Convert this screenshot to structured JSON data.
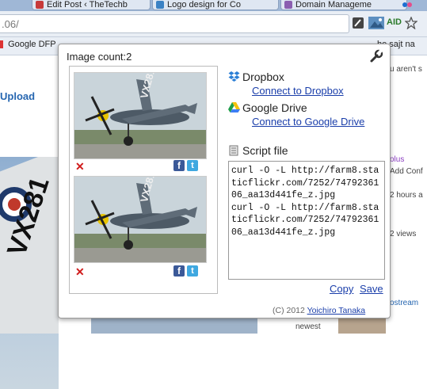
{
  "browser": {
    "tabs": [
      {
        "label": "Edit Post ‹ TheTechb",
        "color": "#c73a3a"
      },
      {
        "label": "Logo design for Co",
        "color": "#3b82c4"
      },
      {
        "label": "Domain Manageme",
        "color": "#8b5fb0"
      }
    ],
    "url_value": ".06/",
    "aid_label": "AID",
    "bookmarks": [
      {
        "label": "Google DFP"
      },
      {
        "label": "he sajt na"
      }
    ]
  },
  "background": {
    "upload_label": "Upload",
    "aircraft_code": "VX281",
    "right_texts": [
      "u aren't s",
      "olus",
      "Add Conf",
      "2 hours a",
      "2 views",
      "ostream",
      "newest"
    ]
  },
  "popup": {
    "image_count_label": "Image count:2",
    "images": [
      {
        "caption": "VX281",
        "delete": "✕",
        "facebook": "f",
        "twitter": "t"
      },
      {
        "caption": "VX281",
        "delete": "✕",
        "facebook": "f",
        "twitter": "t"
      }
    ],
    "dropbox": {
      "title": "Dropbox",
      "link": "Connect to Dropbox"
    },
    "gdrive": {
      "title": "Google Drive",
      "link": "Connect to Google Drive"
    },
    "script": {
      "title": "Script file",
      "content": "curl -O -L http://farm8.staticflickr.com/7252/7479236106_aa13d441fe_z.jpg\ncurl -O -L http://farm8.staticflickr.com/7252/7479236106_aa13d441fe_z.jpg"
    },
    "copy_label": "Copy",
    "save_label": "Save",
    "copyright_prefix": "(C) 2012",
    "author": "Yoichiro Tanaka"
  },
  "colors": {
    "link": "#1a3eaa",
    "delete": "#d01b1b",
    "facebook": "#3b5998",
    "twitter": "#3fa8e0"
  }
}
